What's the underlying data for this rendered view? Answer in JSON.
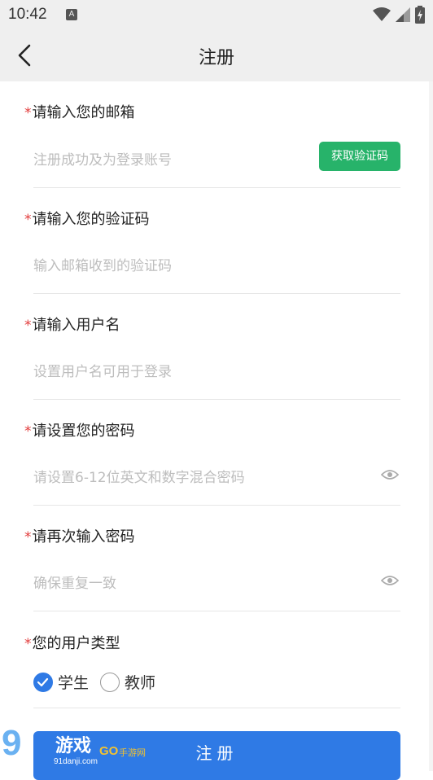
{
  "status": {
    "time": "10:42",
    "notif_letter": "A"
  },
  "header": {
    "title": "注册"
  },
  "colors": {
    "accent": "#2f7ae5",
    "green": "#27b36a",
    "required": "#e23b3b"
  },
  "fields": [
    {
      "label": "请输入您的邮箱",
      "placeholder": "注册成功及为登录账号",
      "button": "获取验证码"
    },
    {
      "label": "请输入您的验证码",
      "placeholder": "输入邮箱收到的验证码"
    },
    {
      "label": "请输入用户名",
      "placeholder": "设置用户名可用于登录"
    },
    {
      "label": "请设置您的密码",
      "placeholder": "请设置6-12位英文和数字混合密码"
    },
    {
      "label": "请再次输入密码",
      "placeholder": "确保重复一致"
    }
  ],
  "required_mark": "*",
  "user_type": {
    "label": "您的用户类型",
    "options": [
      "学生",
      "教师"
    ],
    "selected": "学生"
  },
  "submit_label": "注册",
  "watermark": {
    "number": "9",
    "brand": "游戏",
    "go": "GO",
    "tag": "手游网",
    "site": "91danji.com"
  }
}
